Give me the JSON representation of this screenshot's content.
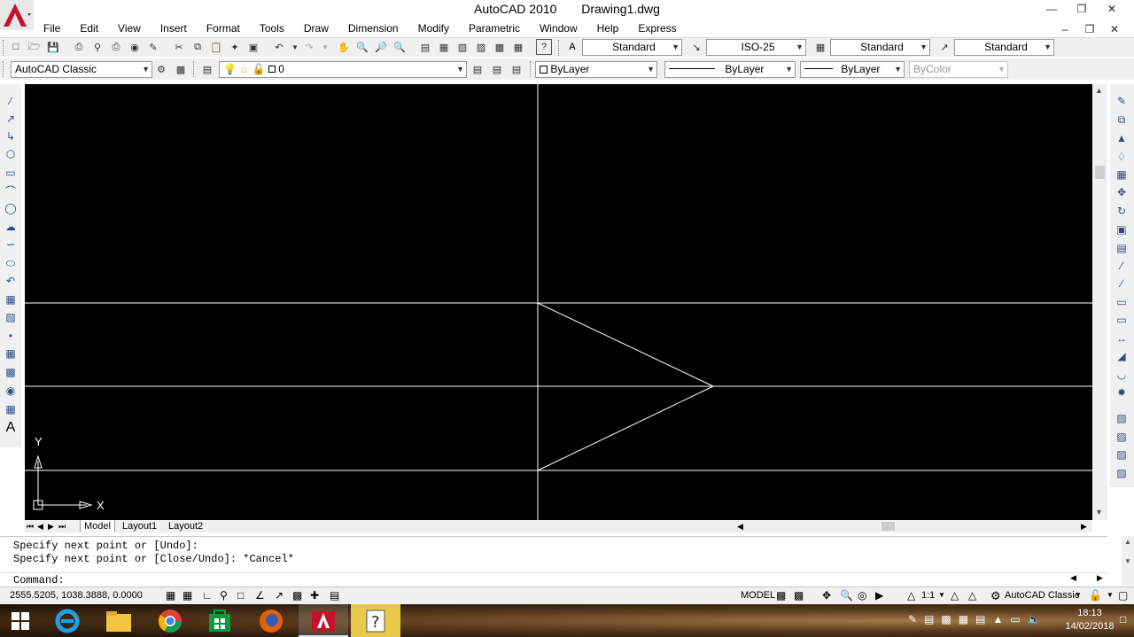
{
  "title": {
    "app": "AutoCAD 2010",
    "doc": "Drawing1.dwg"
  },
  "menu": [
    "File",
    "Edit",
    "View",
    "Insert",
    "Format",
    "Tools",
    "Draw",
    "Dimension",
    "Modify",
    "Parametric",
    "Window",
    "Help",
    "Express"
  ],
  "styles_toolbar": {
    "text_style": "Standard",
    "dim_style": "ISO-25",
    "table_style": "Standard",
    "mleader_style": "Standard"
  },
  "workspace": "AutoCAD Classic",
  "layer": "0",
  "properties": {
    "color": "ByLayer",
    "linetype": "ByLayer",
    "lineweight": "ByLayer",
    "plotstyle": "ByColor"
  },
  "ucs": {
    "y_label": "Y",
    "x_label": "X"
  },
  "layout_tabs": [
    "Model",
    "Layout1",
    "Layout2"
  ],
  "command_history": [
    "Specify next point or [Undo]:",
    "Specify next point or [Close/Undo]: *Cancel*"
  ],
  "command_prompt": "Command:",
  "coordinates": "2555.5205, 1038.3888, 0.0000",
  "status_right": {
    "model": "MODEL",
    "scale": "1:1",
    "workspace": "AutoCAD Classic"
  },
  "taskbar": {
    "time": "18:13",
    "date": "14/02/2018"
  },
  "colors": {
    "canvas": "#000000",
    "lines": "#ffffff",
    "logo": "#c8102e"
  }
}
